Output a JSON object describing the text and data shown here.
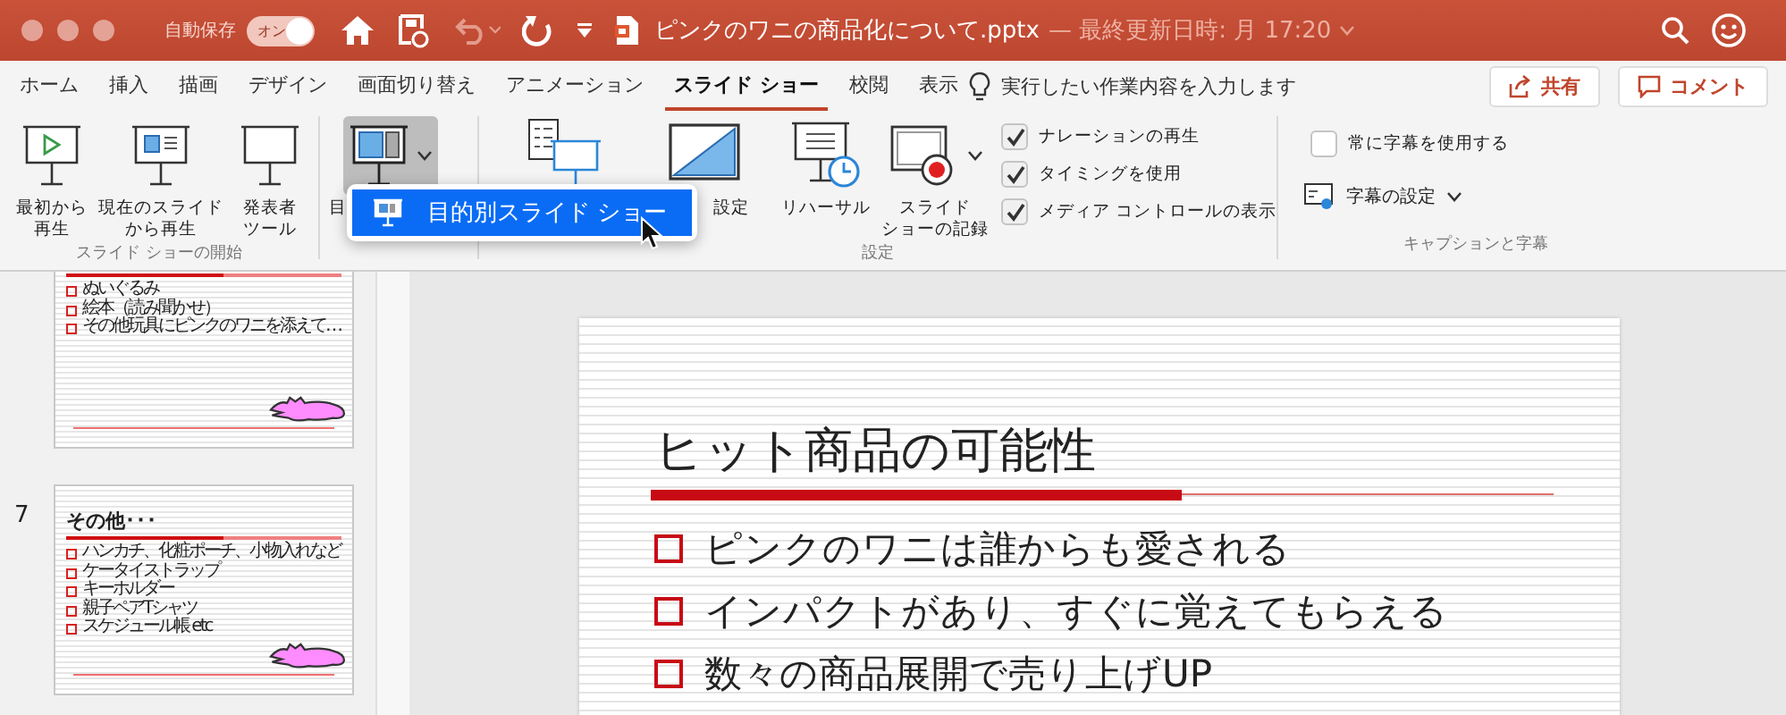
{
  "window": {
    "autosave_label": "自動保存",
    "autosave": {
      "label": "オン",
      "on": true
    },
    "title": "ピンクのワニの商品化について.pptx",
    "subtitle": "— 最終更新日時: 月 17:20"
  },
  "tabs": [
    {
      "label": "ホーム",
      "selected": false
    },
    {
      "label": "挿入",
      "selected": false
    },
    {
      "label": "描画",
      "selected": false
    },
    {
      "label": "デザイン",
      "selected": false
    },
    {
      "label": "画面切り替え",
      "selected": false
    },
    {
      "label": "アニメーション",
      "selected": false
    },
    {
      "label": "スライド ショー",
      "selected": true
    },
    {
      "label": "校閲",
      "selected": false
    },
    {
      "label": "表示",
      "selected": false
    }
  ],
  "tell_me": "実行したい作業内容を入力します",
  "share_button": "共有",
  "comment_button": "コメント",
  "ribbon": {
    "groups": [
      {
        "label": "スライド ショーの開始",
        "items": [
          {
            "kind": "play",
            "lines": [
              "最初から",
              "再生"
            ]
          },
          {
            "kind": "current",
            "lines": [
              "現在のスライド",
              "から再生"
            ]
          },
          {
            "kind": "presenter",
            "lines": [
              "発表者",
              "ツール"
            ]
          }
        ]
      },
      {
        "items": [
          {
            "kind": "custom",
            "lines": [
              "目"
            ],
            "pressed": true,
            "dropdown": true
          }
        ]
      },
      {
        "label": "設定",
        "items": [
          {
            "kind": "hide"
          },
          {
            "kind": "setup",
            "lines": [
              "設定"
            ]
          },
          {
            "kind": "separator"
          },
          {
            "kind": "rehearse",
            "lines": [
              "リハーサル"
            ]
          },
          {
            "kind": "record",
            "lines": [
              "スライド",
              "ショーの記録"
            ],
            "dropdown": true
          },
          {
            "kind": "checks",
            "checks": [
              {
                "label": "ナレーションの再生",
                "checked": true
              },
              {
                "label": "タイミングを使用",
                "checked": true
              },
              {
                "label": "メディア コントロールの表示",
                "checked": true
              }
            ]
          }
        ]
      },
      {
        "label": "キャプションと字幕",
        "items": [
          {
            "kind": "checks",
            "checks": [
              {
                "label": "常に字幕を使用する",
                "checked": false
              }
            ]
          },
          {
            "kind": "menu_button",
            "label": "字幕の設定"
          }
        ]
      }
    ]
  },
  "menu": {
    "items": [
      {
        "label": "目的別スライド ショー",
        "selected": true
      }
    ]
  },
  "thumbnails": [
    {
      "bullets": [
        "ぬいぐるみ",
        "絵本（読み聞かせ）",
        "その他玩具にピンクのワニを添えて…"
      ]
    },
    {
      "number": "7",
      "title": "その他･･･",
      "bullets": [
        "ハンカチ、化粧ポーチ、小物入れなど",
        "ケータイストラップ",
        "キーホルダー",
        "親子ペアTシャツ",
        "スケジュール帳 etc"
      ]
    }
  ],
  "slide": {
    "title": "ヒット商品の可能性",
    "bullets": [
      "ピンクのワニは誰からも愛される",
      "インパクトがあり、すぐに覚えてもらえる",
      "数々の商品展開で売り上げUP"
    ]
  }
}
